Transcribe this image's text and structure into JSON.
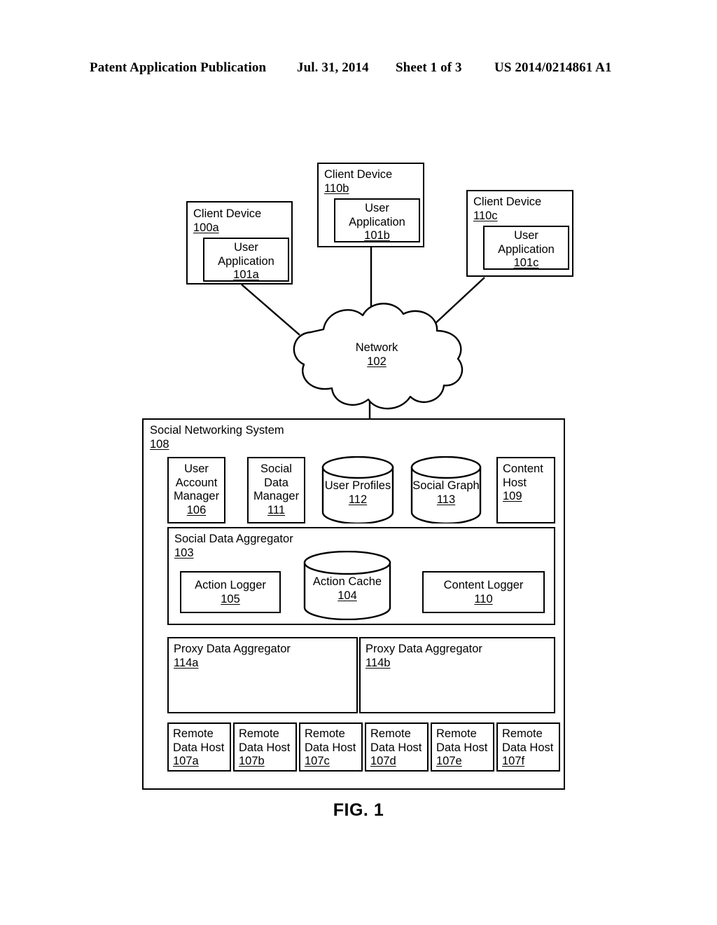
{
  "header": {
    "publication": "Patent Application Publication",
    "date": "Jul. 31, 2014",
    "sheet": "Sheet 1 of 3",
    "patent_number": "US 2014/0214861 A1"
  },
  "figure": {
    "caption": "FIG. 1"
  },
  "clients": [
    {
      "title": "Client Device",
      "ref": "100a",
      "app_line1": "User",
      "app_line2": "Application",
      "app_ref": "101a"
    },
    {
      "title": "Client Device",
      "ref": "110b",
      "app_line1": "User",
      "app_line2": "Application",
      "app_ref": "101b"
    },
    {
      "title": "Client Device",
      "ref": "110c",
      "app_line1": "User",
      "app_line2": "Application",
      "app_ref": "101c"
    }
  ],
  "network": {
    "label": "Network",
    "ref": "102"
  },
  "social_networking_system": {
    "title": "Social Networking System",
    "ref": "108",
    "components": [
      {
        "line1": "User",
        "line2": "Account",
        "line3": "Manager",
        "ref": "106"
      },
      {
        "line1": "Social",
        "line2": "Data",
        "line3": "Manager",
        "ref": "111"
      }
    ],
    "datastores": [
      {
        "label": "User Profiles",
        "ref": "112"
      },
      {
        "label": "Social Graph",
        "ref": "113"
      }
    ],
    "content_host": {
      "line1": "Content",
      "line2": "Host",
      "ref": "109"
    },
    "social_data_aggregator": {
      "title": "Social Data Aggregator",
      "ref": "103",
      "action_logger": {
        "label": "Action Logger",
        "ref": "105"
      },
      "action_cache": {
        "label": "Action Cache",
        "ref": "104"
      },
      "content_logger": {
        "label": "Content Logger",
        "ref": "110"
      }
    },
    "proxy_data_aggregators": [
      {
        "title": "Proxy Data Aggregator",
        "ref": "114a"
      },
      {
        "title": "Proxy Data Aggregator",
        "ref": "114b"
      }
    ],
    "remote_data_hosts": [
      {
        "line1": "Remote",
        "line2": "Data Host",
        "ref": "107a"
      },
      {
        "line1": "Remote",
        "line2": "Data Host",
        "ref": "107b"
      },
      {
        "line1": "Remote",
        "line2": "Data Host",
        "ref": "107c"
      },
      {
        "line1": "Remote",
        "line2": "Data Host",
        "ref": "107d"
      },
      {
        "line1": "Remote",
        "line2": "Data Host",
        "ref": "107e"
      },
      {
        "line1": "Remote",
        "line2": "Data Host",
        "ref": "107f"
      }
    ]
  },
  "colors": {
    "stroke": "#000000",
    "background": "#ffffff"
  }
}
